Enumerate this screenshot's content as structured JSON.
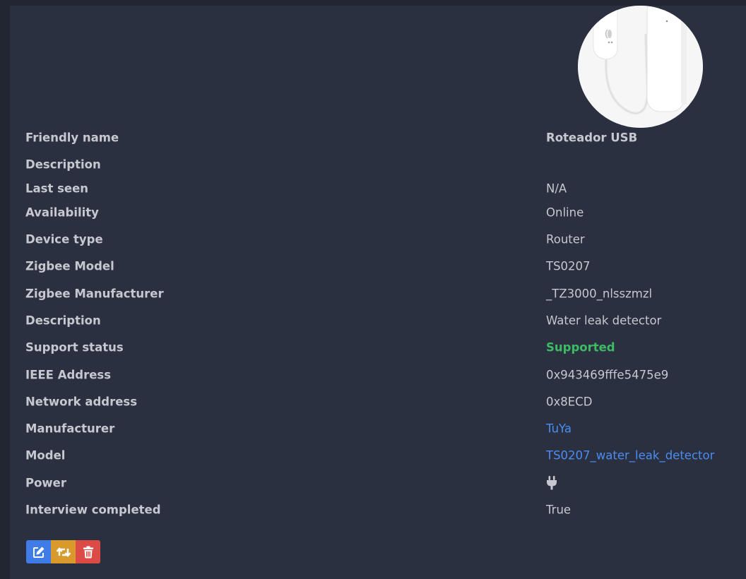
{
  "device": {
    "image_alt": "TS0207 water leak detector device image"
  },
  "rows": [
    {
      "label": "Friendly name",
      "value": "Roteador USB"
    },
    {
      "label": "Description",
      "value": ""
    },
    {
      "label": "Last seen",
      "value": "N/A"
    },
    {
      "label": "Availability",
      "value": "Online"
    },
    {
      "label": "Device type",
      "value": "Router"
    },
    {
      "label": "Zigbee Model",
      "value": "TS0207"
    },
    {
      "label": "Zigbee Manufacturer",
      "value": "_TZ3000_nlsszmzl"
    },
    {
      "label": "Description",
      "value": "Water leak detector"
    },
    {
      "label": "Support status",
      "value": "Supported"
    },
    {
      "label": "IEEE Address",
      "value": "0x943469fffe5475e9"
    },
    {
      "label": "Network address",
      "value": "0x8ECD"
    },
    {
      "label": "Manufacturer",
      "value": "TuYa"
    },
    {
      "label": "Model",
      "value": "TS0207_water_leak_detector"
    },
    {
      "label": "Power",
      "value_icon": "plug-icon"
    },
    {
      "label": "Interview completed",
      "value": "True"
    }
  ],
  "actions": {
    "edit_icon": "edit-icon",
    "rename_icon": "retweet-icon",
    "remove_icon": "trash-icon"
  },
  "colors": {
    "background": "#222633",
    "card": "#2b3040",
    "text": "#c5c8ce",
    "supported": "#3dbb64",
    "link": "#4a8df0",
    "edit_button": "#3f7ce8",
    "rename_button": "#d99a2b",
    "remove_button": "#dc4b45"
  }
}
